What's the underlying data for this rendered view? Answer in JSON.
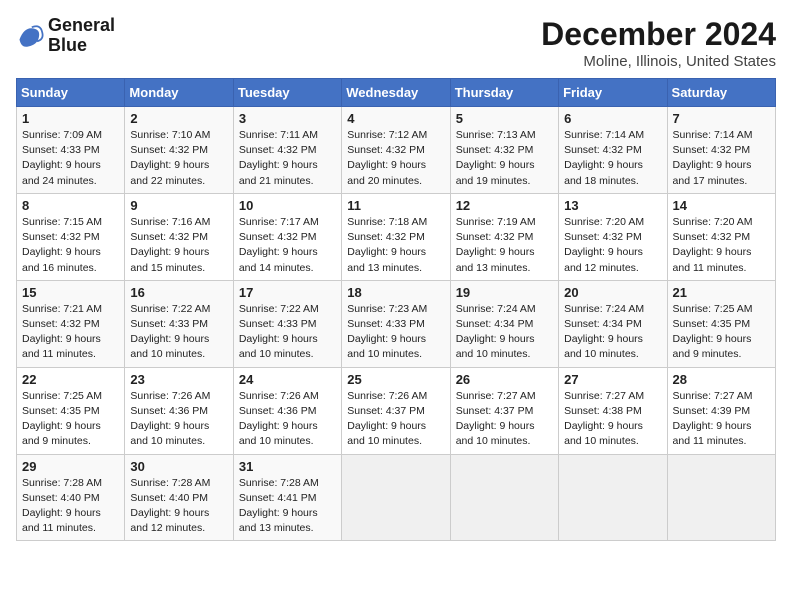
{
  "header": {
    "logo_line1": "General",
    "logo_line2": "Blue",
    "month": "December 2024",
    "location": "Moline, Illinois, United States"
  },
  "weekdays": [
    "Sunday",
    "Monday",
    "Tuesday",
    "Wednesday",
    "Thursday",
    "Friday",
    "Saturday"
  ],
  "weeks": [
    [
      {
        "day": "1",
        "sunrise": "7:09 AM",
        "sunset": "4:33 PM",
        "daylight": "9 hours and 24 minutes."
      },
      {
        "day": "2",
        "sunrise": "7:10 AM",
        "sunset": "4:32 PM",
        "daylight": "9 hours and 22 minutes."
      },
      {
        "day": "3",
        "sunrise": "7:11 AM",
        "sunset": "4:32 PM",
        "daylight": "9 hours and 21 minutes."
      },
      {
        "day": "4",
        "sunrise": "7:12 AM",
        "sunset": "4:32 PM",
        "daylight": "9 hours and 20 minutes."
      },
      {
        "day": "5",
        "sunrise": "7:13 AM",
        "sunset": "4:32 PM",
        "daylight": "9 hours and 19 minutes."
      },
      {
        "day": "6",
        "sunrise": "7:14 AM",
        "sunset": "4:32 PM",
        "daylight": "9 hours and 18 minutes."
      },
      {
        "day": "7",
        "sunrise": "7:14 AM",
        "sunset": "4:32 PM",
        "daylight": "9 hours and 17 minutes."
      }
    ],
    [
      {
        "day": "8",
        "sunrise": "7:15 AM",
        "sunset": "4:32 PM",
        "daylight": "9 hours and 16 minutes."
      },
      {
        "day": "9",
        "sunrise": "7:16 AM",
        "sunset": "4:32 PM",
        "daylight": "9 hours and 15 minutes."
      },
      {
        "day": "10",
        "sunrise": "7:17 AM",
        "sunset": "4:32 PM",
        "daylight": "9 hours and 14 minutes."
      },
      {
        "day": "11",
        "sunrise": "7:18 AM",
        "sunset": "4:32 PM",
        "daylight": "9 hours and 13 minutes."
      },
      {
        "day": "12",
        "sunrise": "7:19 AM",
        "sunset": "4:32 PM",
        "daylight": "9 hours and 13 minutes."
      },
      {
        "day": "13",
        "sunrise": "7:20 AM",
        "sunset": "4:32 PM",
        "daylight": "9 hours and 12 minutes."
      },
      {
        "day": "14",
        "sunrise": "7:20 AM",
        "sunset": "4:32 PM",
        "daylight": "9 hours and 11 minutes."
      }
    ],
    [
      {
        "day": "15",
        "sunrise": "7:21 AM",
        "sunset": "4:32 PM",
        "daylight": "9 hours and 11 minutes."
      },
      {
        "day": "16",
        "sunrise": "7:22 AM",
        "sunset": "4:33 PM",
        "daylight": "9 hours and 10 minutes."
      },
      {
        "day": "17",
        "sunrise": "7:22 AM",
        "sunset": "4:33 PM",
        "daylight": "9 hours and 10 minutes."
      },
      {
        "day": "18",
        "sunrise": "7:23 AM",
        "sunset": "4:33 PM",
        "daylight": "9 hours and 10 minutes."
      },
      {
        "day": "19",
        "sunrise": "7:24 AM",
        "sunset": "4:34 PM",
        "daylight": "9 hours and 10 minutes."
      },
      {
        "day": "20",
        "sunrise": "7:24 AM",
        "sunset": "4:34 PM",
        "daylight": "9 hours and 10 minutes."
      },
      {
        "day": "21",
        "sunrise": "7:25 AM",
        "sunset": "4:35 PM",
        "daylight": "9 hours and 9 minutes."
      }
    ],
    [
      {
        "day": "22",
        "sunrise": "7:25 AM",
        "sunset": "4:35 PM",
        "daylight": "9 hours and 9 minutes."
      },
      {
        "day": "23",
        "sunrise": "7:26 AM",
        "sunset": "4:36 PM",
        "daylight": "9 hours and 10 minutes."
      },
      {
        "day": "24",
        "sunrise": "7:26 AM",
        "sunset": "4:36 PM",
        "daylight": "9 hours and 10 minutes."
      },
      {
        "day": "25",
        "sunrise": "7:26 AM",
        "sunset": "4:37 PM",
        "daylight": "9 hours and 10 minutes."
      },
      {
        "day": "26",
        "sunrise": "7:27 AM",
        "sunset": "4:37 PM",
        "daylight": "9 hours and 10 minutes."
      },
      {
        "day": "27",
        "sunrise": "7:27 AM",
        "sunset": "4:38 PM",
        "daylight": "9 hours and 10 minutes."
      },
      {
        "day": "28",
        "sunrise": "7:27 AM",
        "sunset": "4:39 PM",
        "daylight": "9 hours and 11 minutes."
      }
    ],
    [
      {
        "day": "29",
        "sunrise": "7:28 AM",
        "sunset": "4:40 PM",
        "daylight": "9 hours and 11 minutes."
      },
      {
        "day": "30",
        "sunrise": "7:28 AM",
        "sunset": "4:40 PM",
        "daylight": "9 hours and 12 minutes."
      },
      {
        "day": "31",
        "sunrise": "7:28 AM",
        "sunset": "4:41 PM",
        "daylight": "9 hours and 13 minutes."
      },
      null,
      null,
      null,
      null
    ]
  ],
  "labels": {
    "sunrise": "Sunrise:",
    "sunset": "Sunset:",
    "daylight": "Daylight:"
  }
}
